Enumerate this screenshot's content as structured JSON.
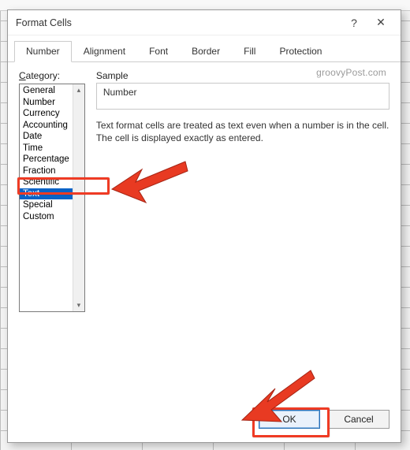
{
  "dialog": {
    "title": "Format Cells",
    "help_tip": "?",
    "close_tip": "✕"
  },
  "tabs": {
    "number": "Number",
    "alignment": "Alignment",
    "font": "Font",
    "border": "Border",
    "fill": "Fill",
    "protection": "Protection",
    "active": "number"
  },
  "category": {
    "label_prefix": "C",
    "label_rest": "ategory:",
    "items": [
      "General",
      "Number",
      "Currency",
      "Accounting",
      "Date",
      "Time",
      "Percentage",
      "Fraction",
      "Scientific",
      "Text",
      "Special",
      "Custom"
    ],
    "selected_index": 9
  },
  "sample": {
    "label": "Sample",
    "value": "Number"
  },
  "description": "Text format cells are treated as text even when a number is in the cell. The cell is displayed exactly as entered.",
  "buttons": {
    "ok": "OK",
    "cancel": "Cancel"
  },
  "watermark": "groovyPost.com",
  "colors": {
    "selection": "#0a63c7",
    "annotation": "#ef3b24",
    "primaryBorder": "#2a6fb5"
  }
}
